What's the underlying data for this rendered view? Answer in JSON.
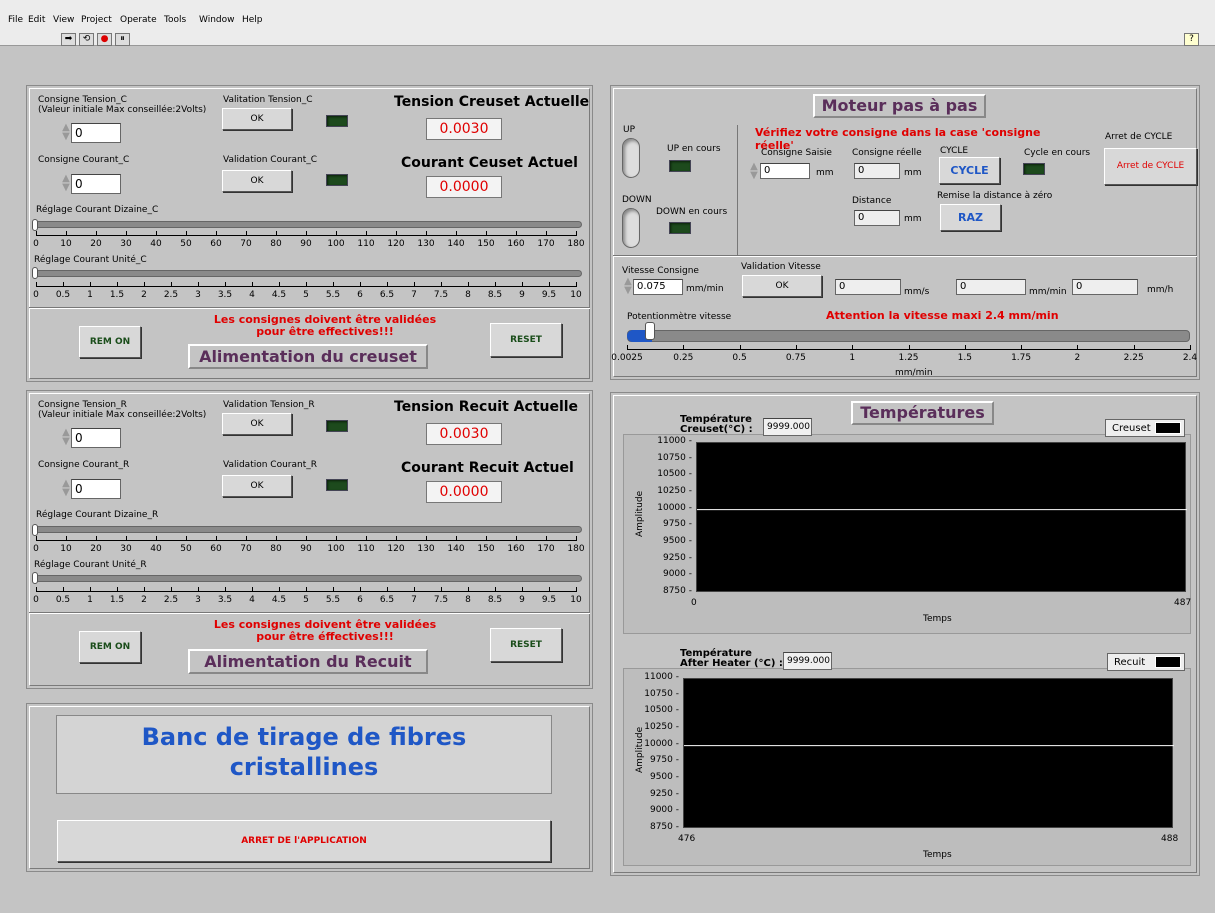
{
  "menu": [
    "File",
    "Edit",
    "View",
    "Project",
    "Operate",
    "Tools",
    "Window",
    "Help"
  ],
  "toolbar": {
    "run": "➡",
    "run_cont": "⟲",
    "abort": "●",
    "pause": "⏸",
    "help": "?"
  },
  "creuset": {
    "cons_tension_label": "Consigne Tension_C",
    "cons_tension_note": "(Valeur initiale Max conseillée:2Volts)",
    "cons_tension_val": "0",
    "valid_tension_label": "Valitation Tension_C",
    "ok": "OK",
    "tension_title": "Tension Creuset Actuelle",
    "tension_val": "0.0030",
    "cons_courant_label": "Consigne Courant_C",
    "cons_courant_val": "0",
    "valid_courant_label": "Validation Courant_C",
    "courant_title": "Courant Ceuset Actuel",
    "courant_val": "0.0000",
    "diz_label": "Réglage Courant Dizaine_C",
    "unit_label": "Réglage Courant Unité_C",
    "remon": "REM ON",
    "reset": "RESET",
    "warn1": "Les consignes doivent être validées",
    "warn2": "pour être effectives!!!",
    "name": "Alimentation du creuset"
  },
  "recuit": {
    "cons_tension_label": "Consigne Tension_R",
    "cons_tension_note": "(Valeur initiale Max conseillée:2Volts)",
    "cons_tension_val": "0",
    "valid_tension_label": "Validation Tension_R",
    "ok": "OK",
    "tension_title": "Tension Recuit Actuelle",
    "tension_val": "0.0030",
    "cons_courant_label": "Consigne Courant_R",
    "cons_courant_val": "0",
    "valid_courant_label": "Validation Courant_R",
    "courant_title": "Courant Recuit Actuel",
    "courant_val": "0.0000",
    "diz_label": "Réglage Courant Dizaine_R",
    "unit_label": "Réglage Courant Unité_R",
    "remon": "REM ON",
    "reset": "RESET",
    "warn1": "Les consignes doivent être validées",
    "warn2": "pour être éffectives!!!",
    "name": "Alimentation du Recuit"
  },
  "diz_ticks": [
    "0",
    "10",
    "20",
    "30",
    "40",
    "50",
    "60",
    "70",
    "80",
    "90",
    "100",
    "110",
    "120",
    "130",
    "140",
    "150",
    "160",
    "170",
    "180"
  ],
  "unit_ticks": [
    "0",
    "0.5",
    "1",
    "1.5",
    "2",
    "2.5",
    "3",
    "3.5",
    "4",
    "4.5",
    "5",
    "5.5",
    "6",
    "6.5",
    "7",
    "7.5",
    "8",
    "8.5",
    "9",
    "9.5",
    "10"
  ],
  "bench": {
    "title1": "Banc de tirage de fibres",
    "title2": "cristallines",
    "stop": "ARRET DE l'APPLICATION"
  },
  "moteur": {
    "title": "Moteur pas à pas",
    "up": "UP",
    "down": "DOWN",
    "up_cours": "UP en cours",
    "down_cours": "DOWN en cours",
    "verify": "Vérifiez votre consigne dans la case 'consigne réelle'",
    "cons_saisie": "Consigne Saisie",
    "cons_saisie_val": "0",
    "mm": "mm",
    "cons_reelle": "Consigne réelle",
    "cons_reelle_val": "0",
    "cycle_label": "CYCLE",
    "cycle_btn": "CYCLE",
    "cycle_cours": "Cycle en cours",
    "arret_label": "Arret de CYCLE",
    "arret_btn": "Arret de CYCLE",
    "distance": "Distance",
    "distance_val": "0",
    "raz_label": "Remise la distance à zéro",
    "raz": "RAZ",
    "vit_cons": "Vitesse Consigne",
    "vit_val": "0.075",
    "mmmin": "mm/min",
    "valid_vit": "Validation Vitesse",
    "ok": "OK",
    "v1": "0",
    "u1": "mm/s",
    "v2": "0",
    "u2": "mm/min",
    "v3": "0",
    "u3": "mm/h",
    "pot": "Potentionmètre vitesse",
    "attention": "Attention la vitesse maxi 2.4 mm/min",
    "speed_ticks": [
      "0.0025",
      "0.25",
      "0.5",
      "0.75",
      "1",
      "1.25",
      "1.5",
      "1.75",
      "2",
      "2.25",
      "2.4"
    ],
    "speed_unit": "mm/min"
  },
  "temps": {
    "title": "Températures",
    "t1_label1": "Température",
    "t1_label2": "Creuset(°C) :",
    "t1_val": "9999.000",
    "t1_legend": "Creuset",
    "t2_label1": "Température",
    "t2_label2": "After Heater (°C) :",
    "t2_val": "9999.000",
    "t2_legend": "Recuit",
    "ylabel": "Amplitude",
    "xlabel": "Temps",
    "yticks": [
      "11000",
      "10750",
      "10500",
      "10250",
      "10000",
      "9750",
      "9500",
      "9250",
      "9000",
      "8750"
    ],
    "g1_xmin": "0",
    "g1_xmax": "487",
    "g2_xmin": "476",
    "g2_xmax": "488"
  },
  "chart_data": [
    {
      "type": "line",
      "title": "",
      "xlabel": "Temps",
      "ylabel": "Amplitude",
      "xlim": [
        0,
        487
      ],
      "ylim": [
        8750,
        11000
      ],
      "series": [
        {
          "name": "Creuset",
          "x": [
            0,
            487
          ],
          "y": [
            10000,
            10000
          ]
        }
      ],
      "grid": false,
      "legend": "top-right"
    },
    {
      "type": "line",
      "title": "",
      "xlabel": "Temps",
      "ylabel": "Amplitude",
      "xlim": [
        476,
        488
      ],
      "ylim": [
        8750,
        11000
      ],
      "series": [
        {
          "name": "Recuit",
          "x": [
            476,
            488
          ],
          "y": [
            10000,
            10000
          ]
        }
      ],
      "grid": false,
      "legend": "top-right"
    }
  ]
}
